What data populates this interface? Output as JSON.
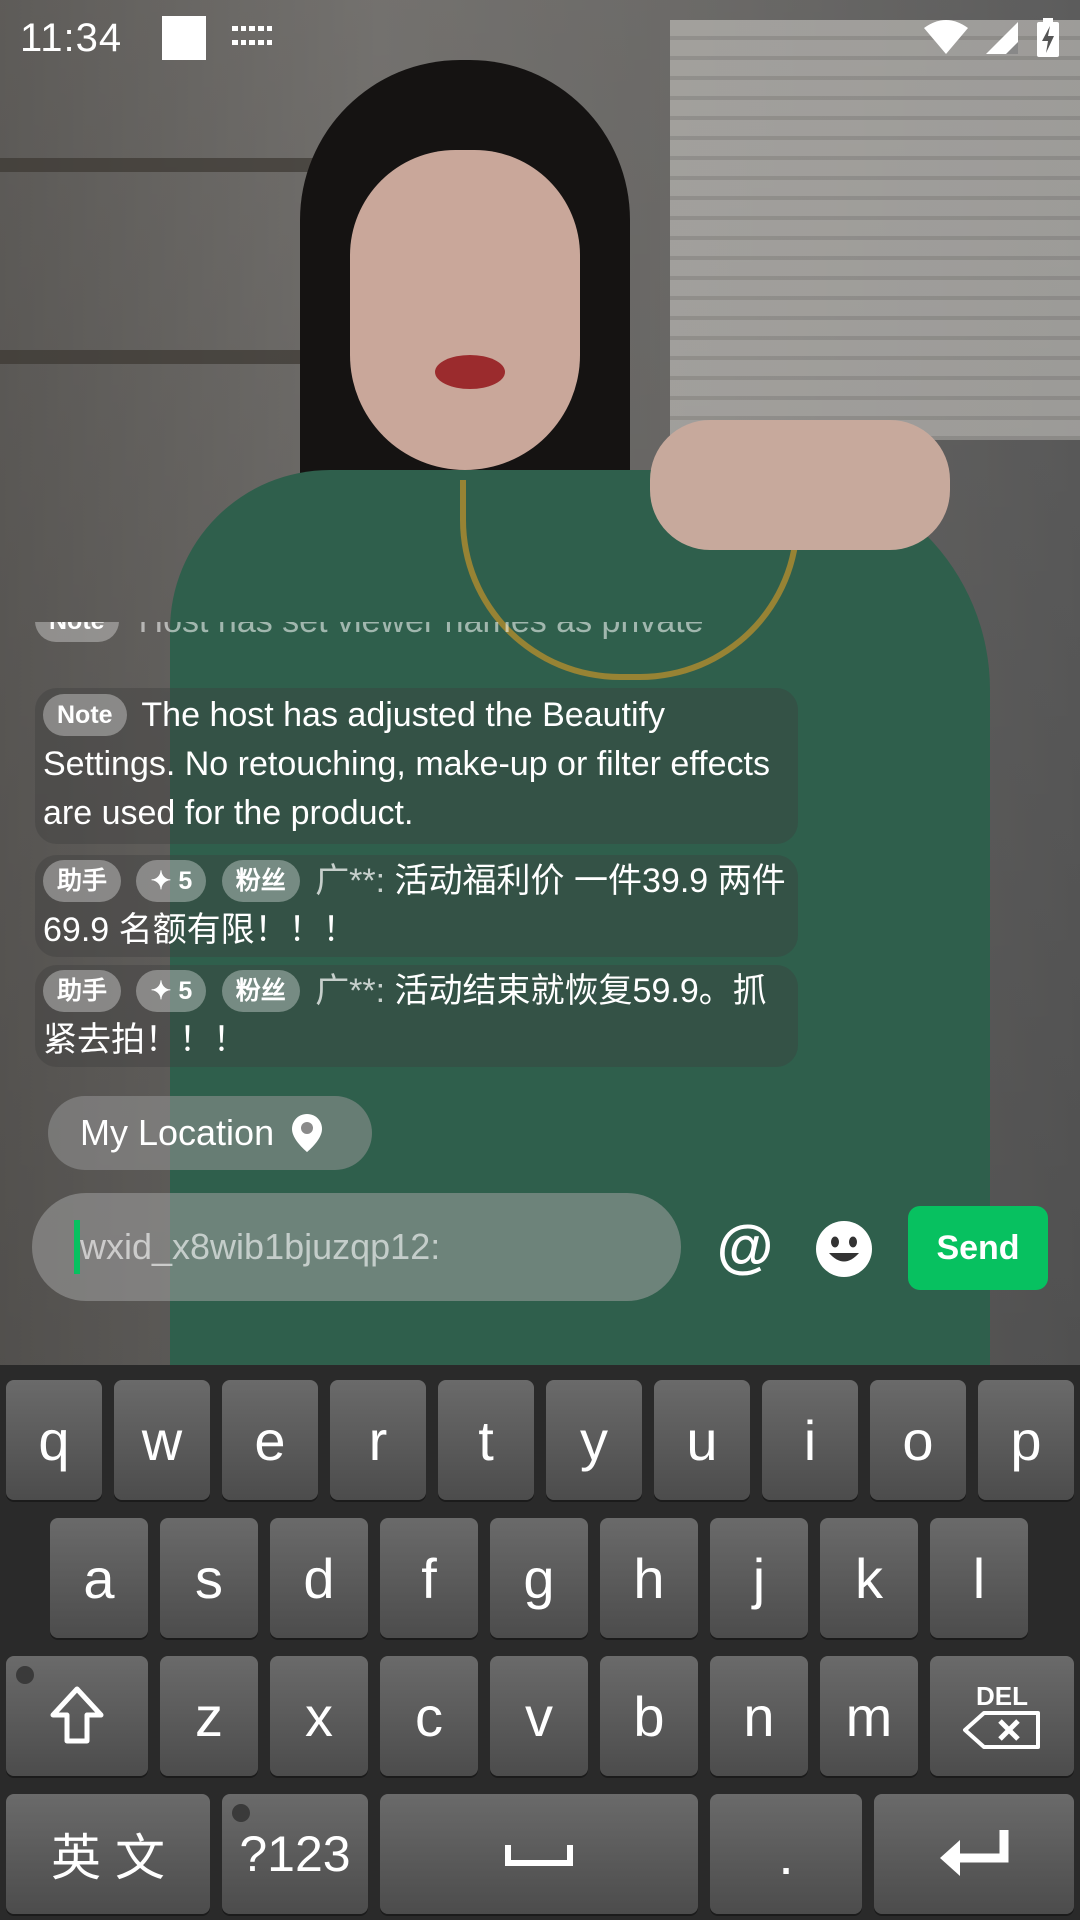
{
  "status_bar": {
    "time": "11:34"
  },
  "comments": {
    "faded": {
      "badge": "Note",
      "text": "Host has set viewer names as private"
    },
    "note": {
      "badge": "Note",
      "text": "The host has adjusted the Beautify Settings. No retouching, make-up or filter effects are used for the product."
    },
    "items": [
      {
        "badges": [
          "助手",
          "✦ 5",
          "粉丝"
        ],
        "user": "广**:",
        "text": " 活动福利价 一件39.9 两件69.9 名额有限！！！"
      },
      {
        "badges": [
          "助手",
          "✦ 5",
          "粉丝"
        ],
        "user": "广**:",
        "text": " 活动结束就恢复59.9。抓紧去拍！！！"
      }
    ]
  },
  "location": {
    "label": "My Location"
  },
  "input": {
    "placeholder": "wxid_x8wib1bjuzqp12:",
    "value": ""
  },
  "actions": {
    "at_label": "@",
    "send_label": "Send"
  },
  "keyboard": {
    "row1": [
      "q",
      "w",
      "e",
      "r",
      "t",
      "y",
      "u",
      "i",
      "o",
      "p"
    ],
    "row2": [
      "a",
      "s",
      "d",
      "f",
      "g",
      "h",
      "j",
      "k",
      "l"
    ],
    "row3": [
      "z",
      "x",
      "c",
      "v",
      "b",
      "n",
      "m"
    ],
    "del_label": "DEL",
    "lang_label": "英 文",
    "sym_label": "?123",
    "period_label": "."
  },
  "icons": {
    "status": [
      "wifi-icon",
      "cell-signal-icon",
      "battery-charging-icon"
    ],
    "location": "location-pin-icon",
    "emoji": "smiley-icon",
    "shift": "shift-arrow-icon",
    "delete": "backspace-icon",
    "space": "space-bar-icon",
    "enter": "enter-arrow-icon"
  },
  "colors": {
    "accent": "#07c160"
  }
}
